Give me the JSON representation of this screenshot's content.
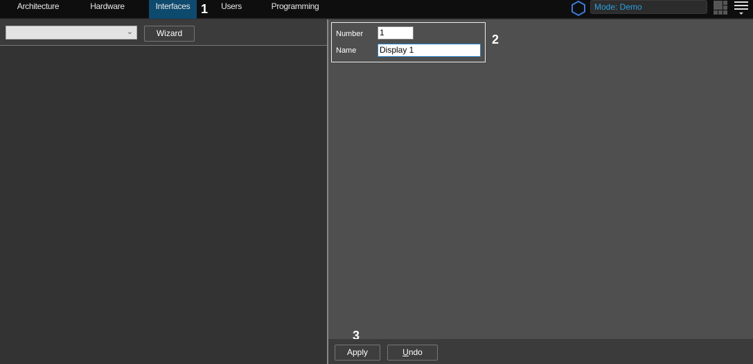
{
  "topbar": {
    "tabs": [
      {
        "label": "Architecture"
      },
      {
        "label": "Hardware"
      },
      {
        "label": "Interfaces",
        "active": true
      },
      {
        "label": "Users"
      },
      {
        "label": "Programming"
      }
    ],
    "mode_label": "Mode: Demo",
    "accent": "#2aa0e0",
    "icons": [
      "hexagon-icon",
      "layout-grid-icon",
      "menu-icon"
    ]
  },
  "markers": {
    "m1": "1",
    "m2": "2",
    "m3": "3"
  },
  "left_toolbar": {
    "combo_value": "",
    "wizard_label": "Wizard"
  },
  "form": {
    "number_label": "Number",
    "number_value": "1",
    "name_label": "Name",
    "name_value": "Display 1"
  },
  "footer": {
    "apply_label": "Apply",
    "undo_label_u": "U",
    "undo_label_rest": "ndo"
  }
}
